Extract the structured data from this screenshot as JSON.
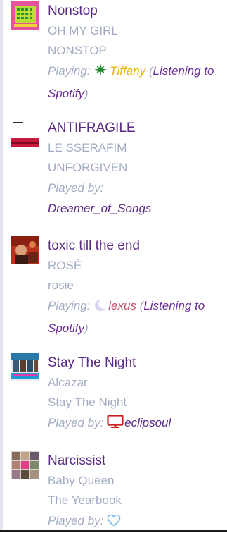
{
  "tracks": [
    {
      "title": "Nonstop",
      "artist": "OH MY GIRL",
      "album": "NONSTOP",
      "status_label": "Playing:",
      "user": "Tiffany",
      "user_icon": "leaf-icon",
      "activity": "Listening to Spotify",
      "cover_icon": "album-cover-nonstop"
    },
    {
      "title": "ANTIFRAGILE",
      "artist": "LE SSERAFIM",
      "album": "UNFORGIVEN",
      "status_label": "Played by:",
      "user": "Dreamer_of_Songs",
      "cover_icon": "album-cover-unforgiven"
    },
    {
      "title": "toxic till the end",
      "artist": "ROSÉ",
      "album": "rosie",
      "status_label": "Playing:",
      "user": "lexus",
      "user_icon": "moon-icon",
      "activity": "Listening to Spotify",
      "cover_icon": "album-cover-rosie"
    },
    {
      "title": "Stay The Night",
      "artist": "Alcazar",
      "album": "Stay The Night",
      "status_label": "Played by:",
      "user": "eclipsoul",
      "user_icon": "monitor-icon",
      "cover_icon": "album-cover-stay-the-night"
    },
    {
      "title": "Narcissist",
      "artist": "Baby Queen",
      "album": "The Yearbook",
      "status_label": "Played by:",
      "user_icon": "heart-outline-icon",
      "cover_icon": "album-cover-the-yearbook"
    }
  ],
  "colors": {
    "title": "#5b2a86",
    "meta": "#a3acc3",
    "user_gold": "#e9b208",
    "user_rose": "#c0546d",
    "activity": "#6b2e99",
    "leaf": "#1f8a2e",
    "monitor": "#cc1f1f",
    "heart": "#7ab8e6"
  }
}
